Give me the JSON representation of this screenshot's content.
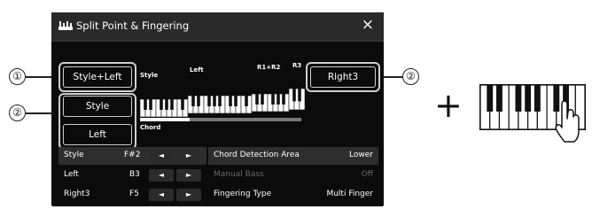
{
  "callouts": {
    "one": "①",
    "two_a": "②",
    "two_b": "②"
  },
  "window": {
    "title": "Split Point & Fingering",
    "close_icon": "×"
  },
  "buttons": {
    "style_left": "Style+Left",
    "style": "Style",
    "left": "Left",
    "right3": "Right3"
  },
  "keyboard": {
    "label_style": "Style",
    "label_left": "Left",
    "label_r1r2": "R1+R2",
    "label_r3": "R3",
    "label_chord": "Chord"
  },
  "split_rows": [
    {
      "part": "Style",
      "note": "F#2",
      "dec": "◄",
      "inc": "►"
    },
    {
      "part": "Left",
      "note": "B3",
      "dec": "◄",
      "inc": "►"
    },
    {
      "part": "Right3",
      "note": "F5",
      "dec": "◄",
      "inc": "►"
    }
  ],
  "settings_rows": [
    {
      "label": "Chord Detection Area",
      "value": "Lower"
    },
    {
      "label": "Manual Bass",
      "value": "Off"
    },
    {
      "label": "Fingering Type",
      "value": "Multi Finger"
    }
  ],
  "plus_symbol": "+",
  "colors": {
    "panel": "#0b0b0b",
    "titlebar": "#2a2a2a",
    "selected_row": "#2e2e2e",
    "dim_text": "#6a6a6a"
  }
}
